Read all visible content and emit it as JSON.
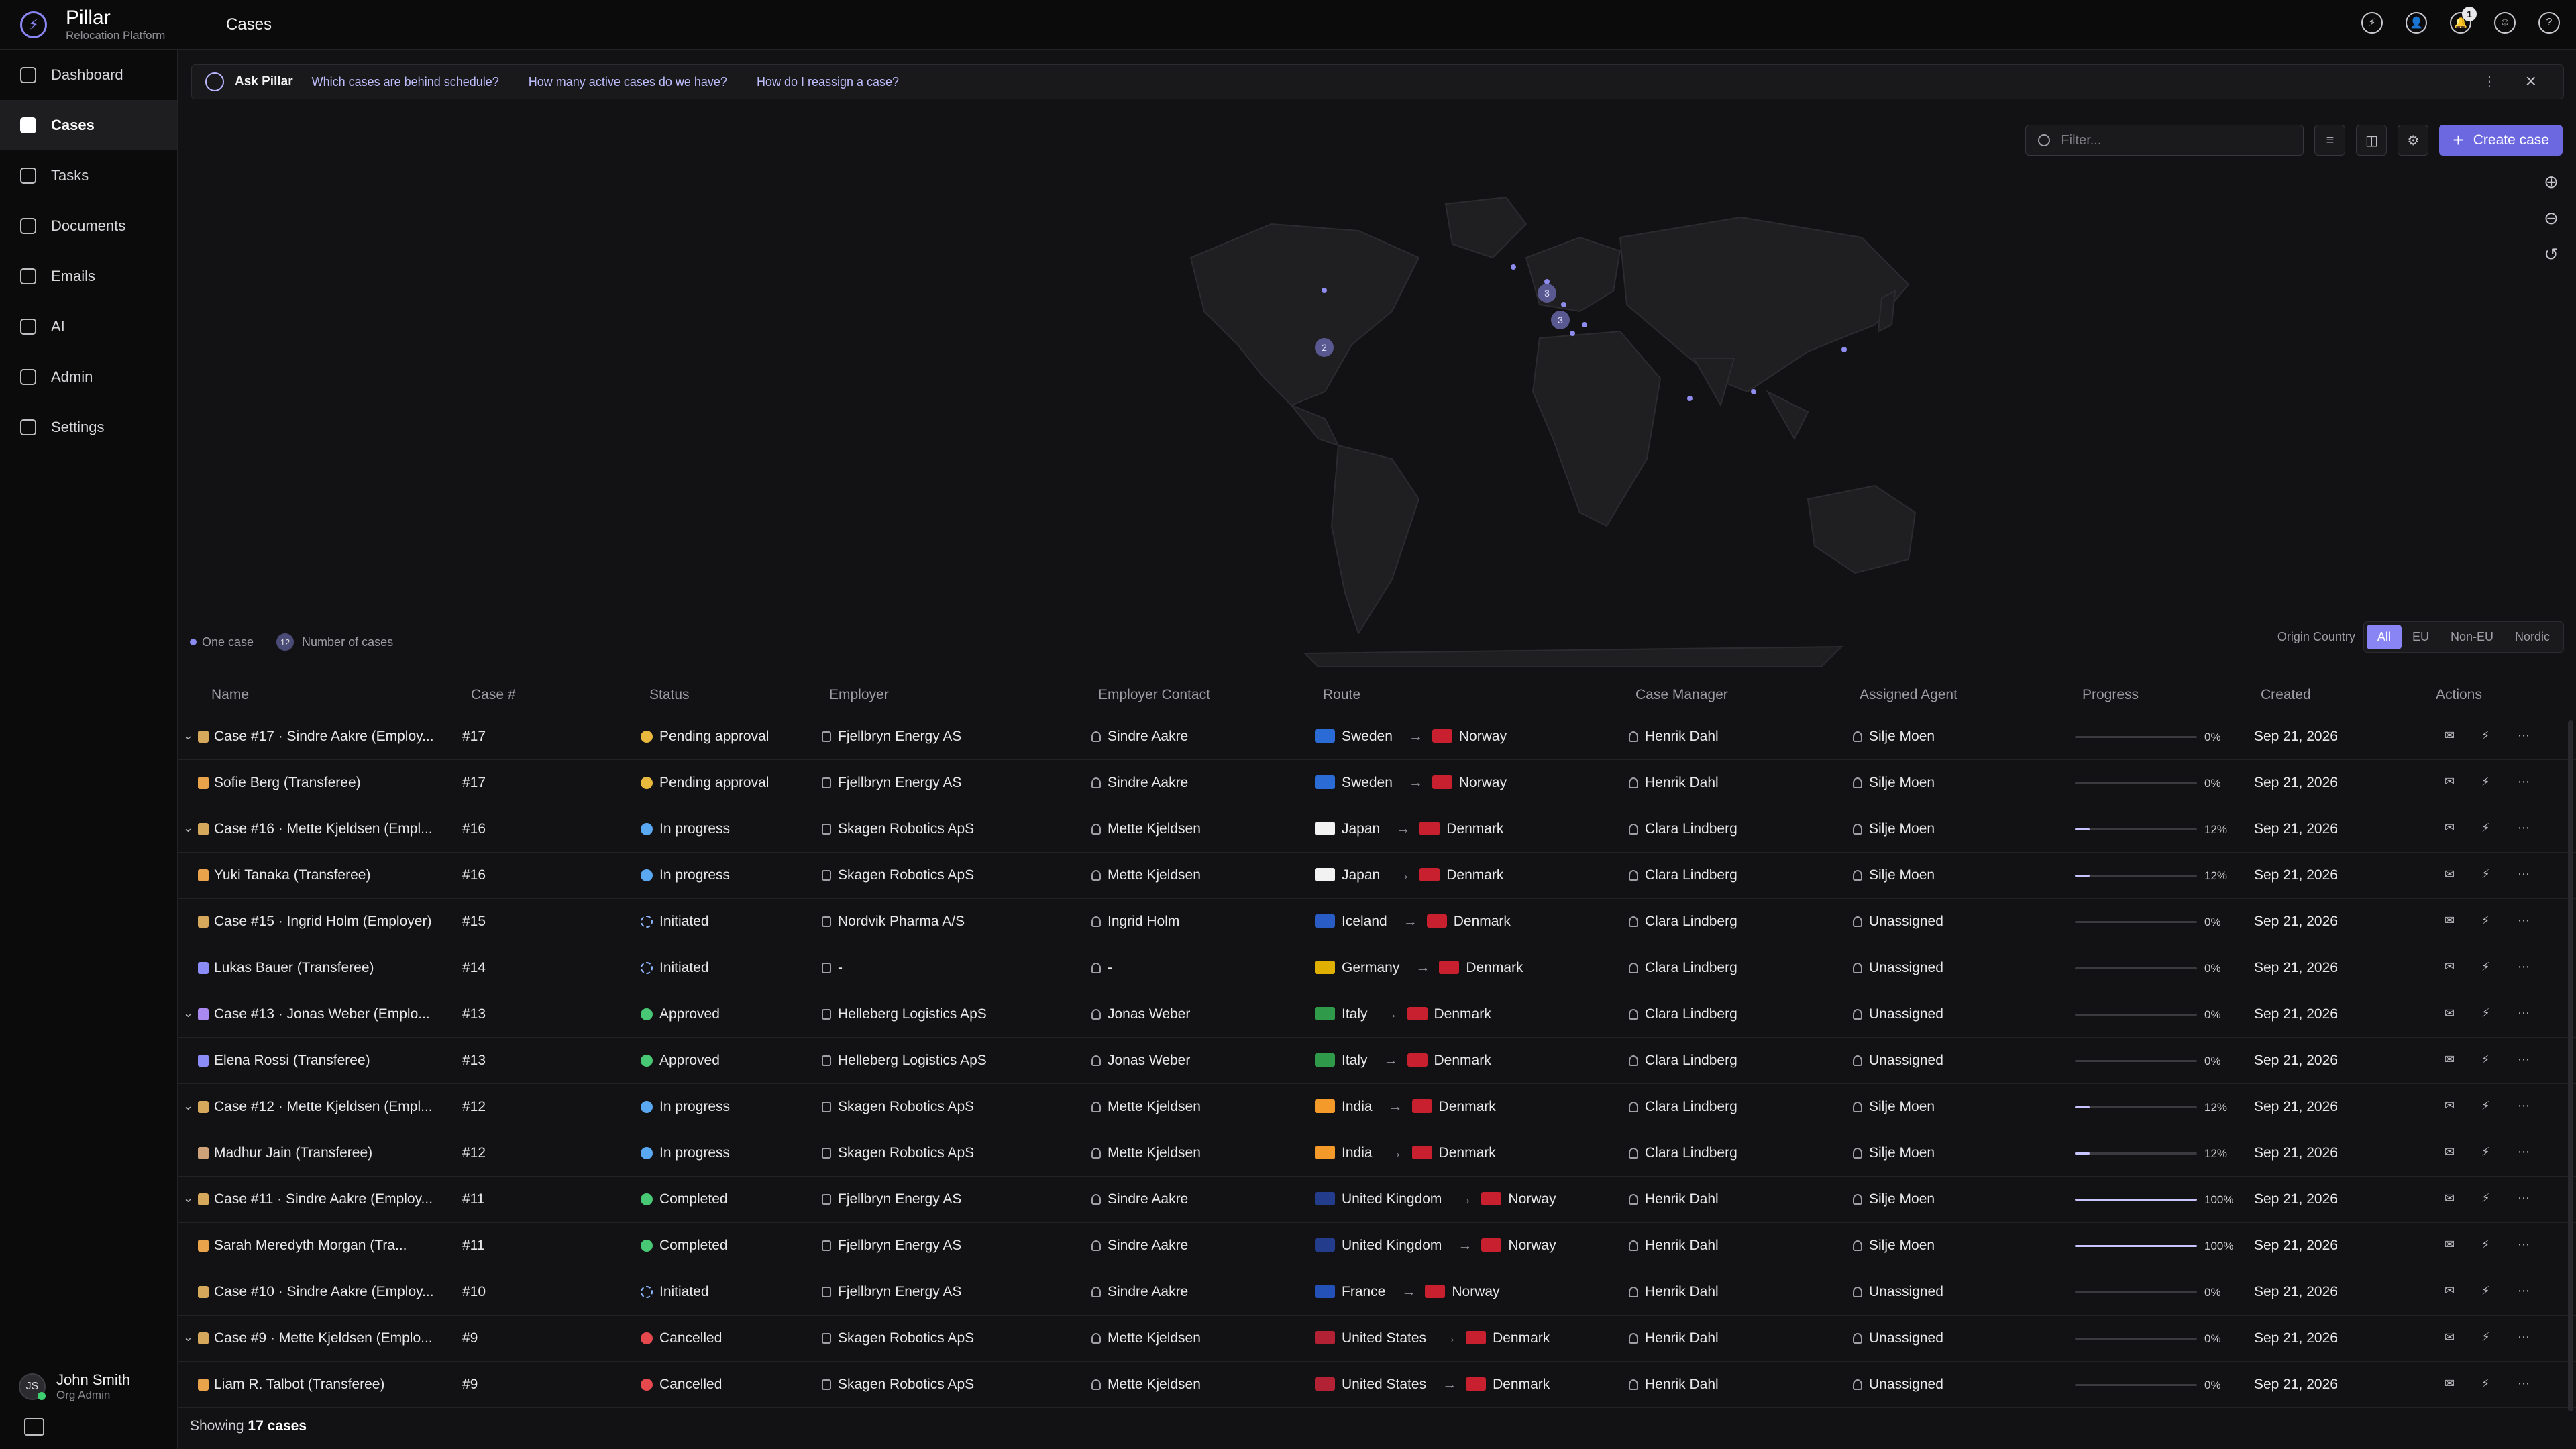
{
  "app": {
    "name": "Pillar",
    "subtitle": "Relocation Platform",
    "page_title": "Cases",
    "notification_count": "1"
  },
  "nav": [
    {
      "label": "Dashboard",
      "icon": "dashboard-icon"
    },
    {
      "label": "Cases",
      "icon": "briefcase-icon",
      "active": true
    },
    {
      "label": "Tasks",
      "icon": "tasks-icon"
    },
    {
      "label": "Documents",
      "icon": "documents-icon"
    },
    {
      "label": "Emails",
      "icon": "mail-icon"
    },
    {
      "label": "AI",
      "icon": "ai-icon"
    },
    {
      "label": "Admin",
      "icon": "admin-icon"
    },
    {
      "label": "Settings",
      "icon": "gear-icon"
    }
  ],
  "user": {
    "initials": "JS",
    "name": "John Smith",
    "role": "Org Admin"
  },
  "ask": {
    "title": "Ask Pillar",
    "questions": [
      "Which cases are behind schedule?",
      "How many active cases do we have?",
      "How do I reassign a case?"
    ]
  },
  "toolbar": {
    "filter_placeholder": "Filter...",
    "create_label": "Create case"
  },
  "map": {
    "legend_one": "One case",
    "legend_num_sample": "12",
    "legend_num": "Number of cases",
    "cluster_labels": [
      "3",
      "3",
      "2"
    ],
    "origin_label": "Origin Country",
    "origin_options": [
      "All",
      "EU",
      "Non-EU",
      "Nordic"
    ]
  },
  "table": {
    "headers": [
      "Name",
      "Case #",
      "Status",
      "Employer",
      "Employer Contact",
      "Route",
      "Case Manager",
      "Assigned Agent",
      "Progress",
      "Created",
      "Actions"
    ],
    "rows": [
      {
        "caret": true,
        "name": "Case #17 · Sindre Aakre (Employ...",
        "type": "employer",
        "case": "#17",
        "status": "Pending approval",
        "scolor": "#e8b93c",
        "employer": "Fjellbryn Energy AS",
        "contact": "Sindre Aakre",
        "from": "Sweden",
        "fromFlag": "#2b6bd6",
        "to": "Norway",
        "toFlag": "#c8202f",
        "manager": "Henrik Dahl",
        "agent": "Silje Moen",
        "progress": 0,
        "progress_text": "0%",
        "created": "Sep 21, 2026"
      },
      {
        "caret": false,
        "name": "Sofie Berg (Transferee)",
        "type": "transferee",
        "case": "#17",
        "status": "Pending approval",
        "scolor": "#e8b93c",
        "employer": "Fjellbryn Energy AS",
        "contact": "Sindre Aakre",
        "from": "Sweden",
        "fromFlag": "#2b6bd6",
        "to": "Norway",
        "toFlag": "#c8202f",
        "manager": "Henrik Dahl",
        "agent": "Silje Moen",
        "progress": 0,
        "progress_text": "0%",
        "created": "Sep 21, 2026"
      },
      {
        "caret": true,
        "name": "Case #16 · Mette Kjeldsen (Empl...",
        "type": "employer",
        "case": "#16",
        "status": "In progress",
        "scolor": "#5aa7f2",
        "employer": "Skagen Robotics ApS",
        "contact": "Mette Kjeldsen",
        "from": "Japan",
        "fromFlag": "#f2f2f2",
        "to": "Denmark",
        "toFlag": "#c8202f",
        "manager": "Clara Lindberg",
        "agent": "Silje Moen",
        "progress": 12,
        "progress_text": "12%",
        "created": "Sep 21, 2026"
      },
      {
        "caret": false,
        "name": "Yuki Tanaka (Transferee)",
        "type": "transferee",
        "case": "#16",
        "status": "In progress",
        "scolor": "#5aa7f2",
        "employer": "Skagen Robotics ApS",
        "contact": "Mette Kjeldsen",
        "from": "Japan",
        "fromFlag": "#f2f2f2",
        "to": "Denmark",
        "toFlag": "#c8202f",
        "manager": "Clara Lindberg",
        "agent": "Silje Moen",
        "progress": 12,
        "progress_text": "12%",
        "created": "Sep 21, 2026"
      },
      {
        "caret": false,
        "name": "Case #15 · Ingrid Holm (Employer)",
        "type": "employer",
        "case": "#15",
        "status": "Initiated",
        "scolor": "init",
        "employer": "Nordvik Pharma A/S",
        "contact": "Ingrid Holm",
        "from": "Iceland",
        "fromFlag": "#2a5cc5",
        "to": "Denmark",
        "toFlag": "#c8202f",
        "manager": "Clara Lindberg",
        "agent": "Unassigned",
        "progress": 0,
        "progress_text": "0%",
        "created": "Sep 21, 2026"
      },
      {
        "caret": false,
        "name": "Lukas Bauer (Transferee)",
        "type": "transferee2",
        "case": "#14",
        "status": "Initiated",
        "scolor": "init",
        "employer": "-",
        "contact": "-",
        "from": "Germany",
        "fromFlag": "#e0b000",
        "to": "Denmark",
        "toFlag": "#c8202f",
        "manager": "Clara Lindberg",
        "agent": "Unassigned",
        "progress": 0,
        "progress_text": "0%",
        "created": "Sep 21, 2026"
      },
      {
        "caret": true,
        "name": "Case #13 · Jonas Weber (Emplo...",
        "type": "employer2",
        "case": "#13",
        "status": "Approved",
        "scolor": "#48c774",
        "employer": "Helleberg Logistics ApS",
        "contact": "Jonas Weber",
        "from": "Italy",
        "fromFlag": "#2f9a4a",
        "to": "Denmark",
        "toFlag": "#c8202f",
        "manager": "Clara Lindberg",
        "agent": "Unassigned",
        "progress": 0,
        "progress_text": "0%",
        "created": "Sep 21, 2026"
      },
      {
        "caret": false,
        "name": "Elena Rossi (Transferee)",
        "type": "transferee2",
        "case": "#13",
        "status": "Approved",
        "scolor": "#48c774",
        "employer": "Helleberg Logistics ApS",
        "contact": "Jonas Weber",
        "from": "Italy",
        "fromFlag": "#2f9a4a",
        "to": "Denmark",
        "toFlag": "#c8202f",
        "manager": "Clara Lindberg",
        "agent": "Unassigned",
        "progress": 0,
        "progress_text": "0%",
        "created": "Sep 21, 2026"
      },
      {
        "caret": true,
        "name": "Case #12 · Mette Kjeldsen (Empl...",
        "type": "employer",
        "case": "#12",
        "status": "In progress",
        "scolor": "#5aa7f2",
        "employer": "Skagen Robotics ApS",
        "contact": "Mette Kjeldsen",
        "from": "India",
        "fromFlag": "#f39a2b",
        "to": "Denmark",
        "toFlag": "#c8202f",
        "manager": "Clara Lindberg",
        "agent": "Silje Moen",
        "progress": 12,
        "progress_text": "12%",
        "created": "Sep 21, 2026"
      },
      {
        "caret": false,
        "name": "Madhur Jain (Transferee)",
        "type": "transferee3",
        "case": "#12",
        "status": "In progress",
        "scolor": "#5aa7f2",
        "employer": "Skagen Robotics ApS",
        "contact": "Mette Kjeldsen",
        "from": "India",
        "fromFlag": "#f39a2b",
        "to": "Denmark",
        "toFlag": "#c8202f",
        "manager": "Clara Lindberg",
        "agent": "Silje Moen",
        "progress": 12,
        "progress_text": "12%",
        "created": "Sep 21, 2026"
      },
      {
        "caret": true,
        "name": "Case #11 · Sindre Aakre (Employ...",
        "type": "employer",
        "case": "#11",
        "status": "Completed",
        "scolor": "#48c774",
        "employer": "Fjellbryn Energy AS",
        "contact": "Sindre Aakre",
        "from": "United Kingdom",
        "fromFlag": "#233c8c",
        "to": "Norway",
        "toFlag": "#c8202f",
        "manager": "Henrik Dahl",
        "agent": "Silje Moen",
        "progress": 100,
        "progress_text": "100%",
        "created": "Sep 21, 2026"
      },
      {
        "caret": false,
        "name": "Sarah Meredyth Morgan (Tra...",
        "type": "transferee",
        "case": "#11",
        "status": "Completed",
        "scolor": "#48c774",
        "employer": "Fjellbryn Energy AS",
        "contact": "Sindre Aakre",
        "from": "United Kingdom",
        "fromFlag": "#233c8c",
        "to": "Norway",
        "toFlag": "#c8202f",
        "manager": "Henrik Dahl",
        "agent": "Silje Moen",
        "progress": 100,
        "progress_text": "100%",
        "created": "Sep 21, 2026"
      },
      {
        "caret": false,
        "name": "Case #10 · Sindre Aakre (Employ...",
        "type": "employer",
        "case": "#10",
        "status": "Initiated",
        "scolor": "init",
        "employer": "Fjellbryn Energy AS",
        "contact": "Sindre Aakre",
        "from": "France",
        "fromFlag": "#2451b7",
        "to": "Norway",
        "toFlag": "#c8202f",
        "manager": "Henrik Dahl",
        "agent": "Unassigned",
        "progress": 0,
        "progress_text": "0%",
        "created": "Sep 21, 2026"
      },
      {
        "caret": true,
        "name": "Case #9 · Mette Kjeldsen (Emplo...",
        "type": "employer",
        "case": "#9",
        "status": "Cancelled",
        "scolor": "#e5484d",
        "employer": "Skagen Robotics ApS",
        "contact": "Mette Kjeldsen",
        "from": "United States",
        "fromFlag": "#b22234",
        "to": "Denmark",
        "toFlag": "#c8202f",
        "manager": "Henrik Dahl",
        "agent": "Unassigned",
        "progress": 0,
        "progress_text": "0%",
        "created": "Sep 21, 2026"
      },
      {
        "caret": false,
        "name": "Liam R. Talbot (Transferee)",
        "type": "transferee",
        "case": "#9",
        "status": "Cancelled",
        "scolor": "#e5484d",
        "employer": "Skagen Robotics ApS",
        "contact": "Mette Kjeldsen",
        "from": "United States",
        "fromFlag": "#b22234",
        "to": "Denmark",
        "toFlag": "#c8202f",
        "manager": "Henrik Dahl",
        "agent": "Unassigned",
        "progress": 0,
        "progress_text": "0%",
        "created": "Sep 21, 2026"
      }
    ]
  },
  "footer": {
    "prefix": "Showing",
    "count": "17 cases"
  }
}
